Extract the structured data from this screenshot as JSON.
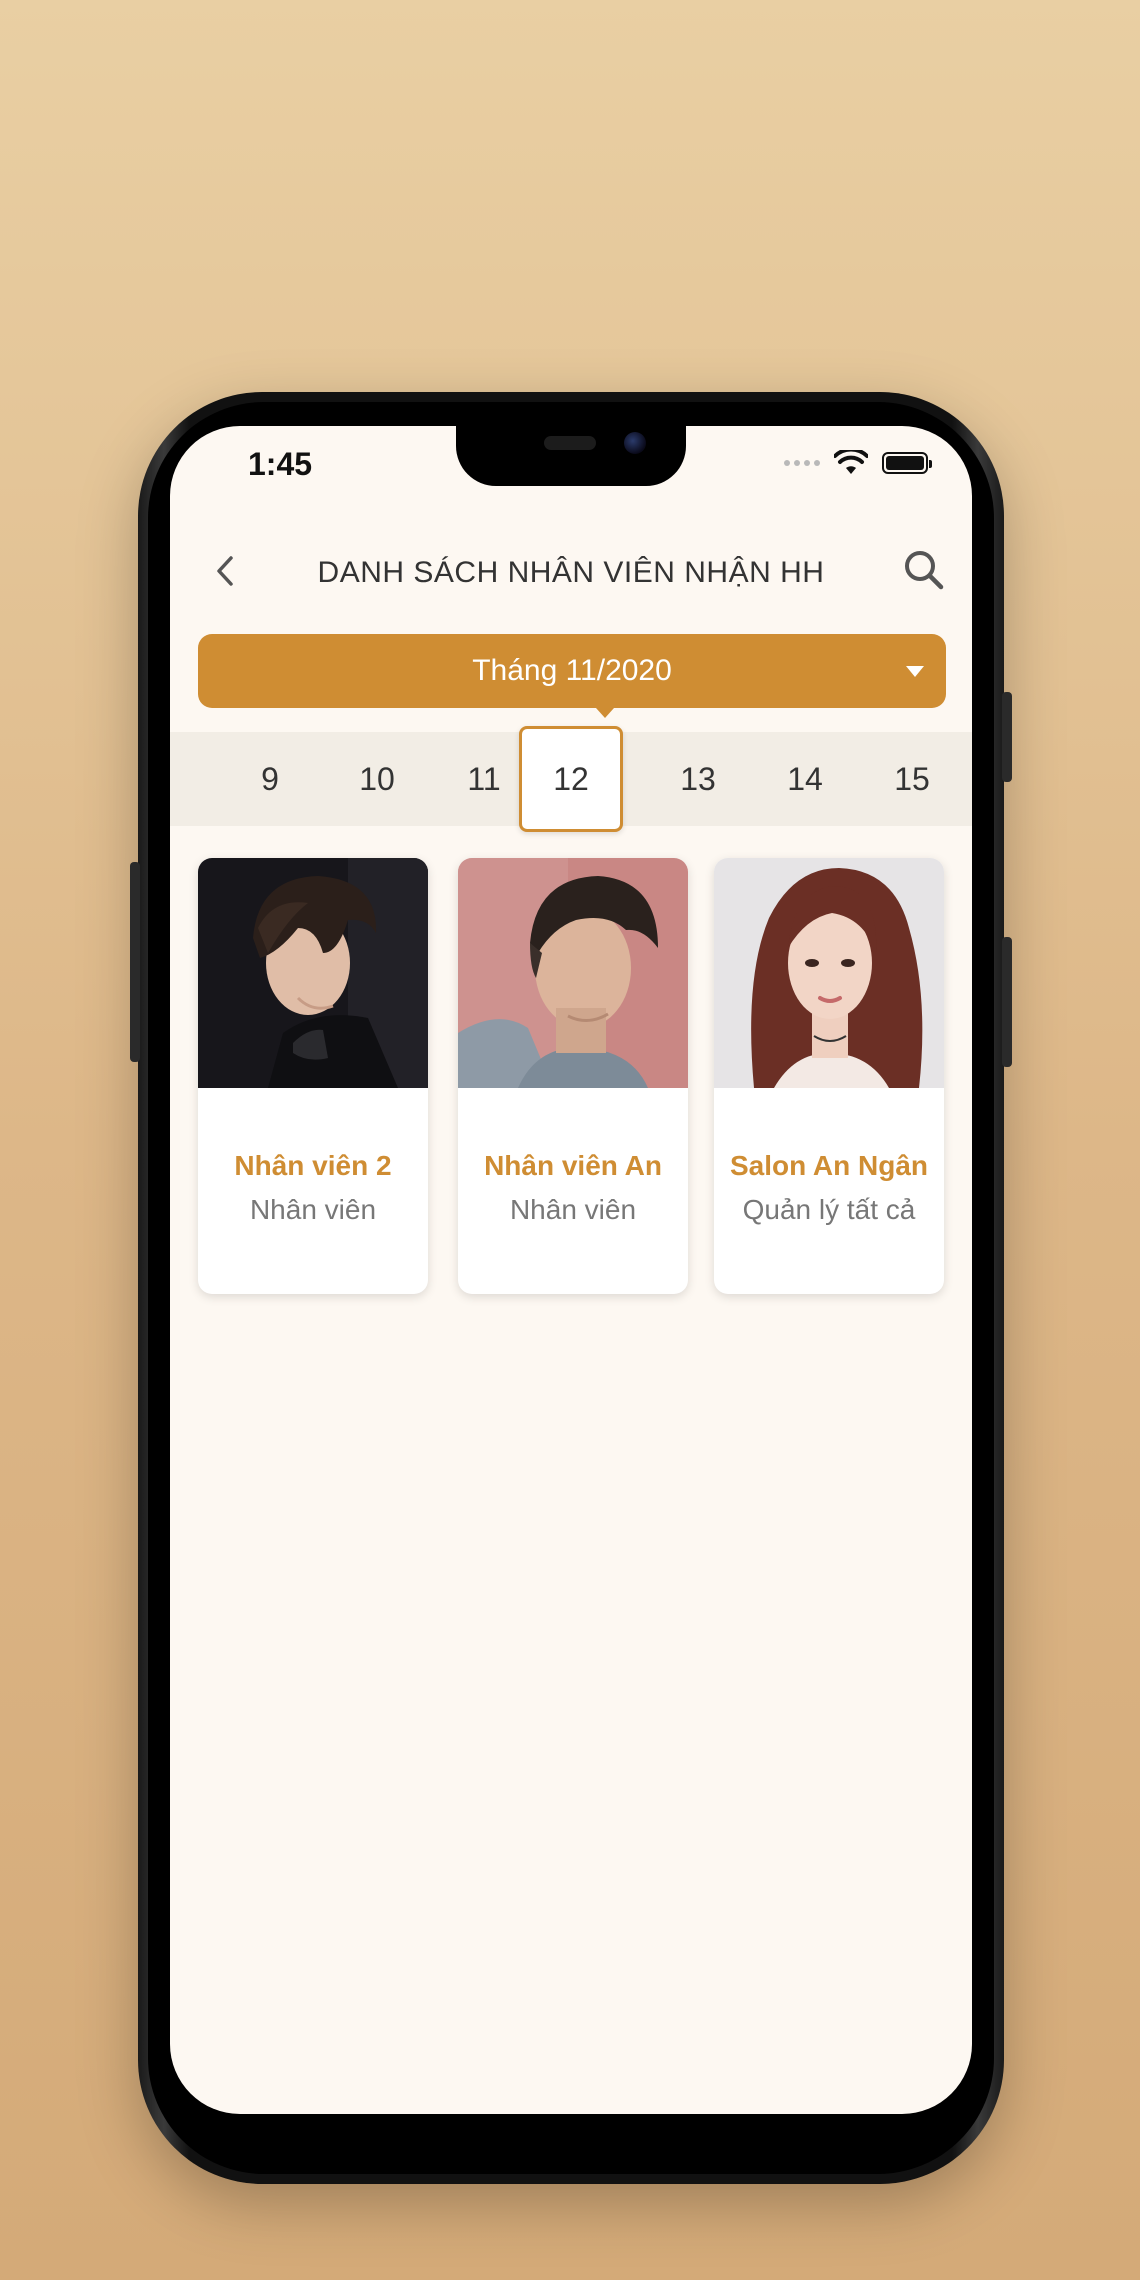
{
  "status_bar": {
    "time": "1:45"
  },
  "header": {
    "title": "DANH SÁCH NHÂN VIÊN NHẬN HH",
    "back_icon": "chevron-left-icon",
    "search_icon": "search-icon"
  },
  "month_selector": {
    "label": "Tháng 11/2020",
    "dropdown_icon": "caret-down-icon"
  },
  "days": {
    "items": [
      "9",
      "10",
      "11",
      "12",
      "13",
      "14",
      "15"
    ],
    "selected": "12"
  },
  "staff": [
    {
      "name": "Nhân viên 2",
      "role": "Nhân viên"
    },
    {
      "name": "Nhân viên An",
      "role": "Nhân viên"
    },
    {
      "name": "Salon An Ngân",
      "role": "Quản lý tất cả"
    }
  ],
  "colors": {
    "accent": "#cf8d33",
    "background": "#fdf8f2",
    "day_strip": "#f2ede5",
    "text_primary": "#333333",
    "text_secondary": "#777777"
  }
}
